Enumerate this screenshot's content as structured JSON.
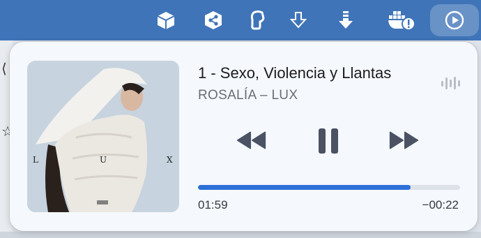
{
  "menubar": {
    "icons": [
      "cube-icon",
      "share-icon",
      "hanger-icon",
      "download-outline-icon",
      "download-filled-icon",
      "docker-icon",
      "play-circle-icon"
    ],
    "colors": {
      "background": "#3f74b8",
      "icon": "#ffffff"
    }
  },
  "now_playing": {
    "track_title": "1 - Sexo, Violencia y Llantas",
    "subtitle": "ROSALÍA – LUX",
    "artwork": {
      "description_icon": "album-artwork",
      "letters": [
        "L",
        "U",
        "X"
      ]
    },
    "controls": {
      "rewind": "rewind-icon",
      "pause": "pause-icon",
      "fast_forward": "fast-forward-icon"
    },
    "progress_fraction": 0.81,
    "elapsed": "01:59",
    "remaining": "−00:22",
    "colors": {
      "accent": "#2d6fd9",
      "controls": "#4a5264"
    }
  }
}
